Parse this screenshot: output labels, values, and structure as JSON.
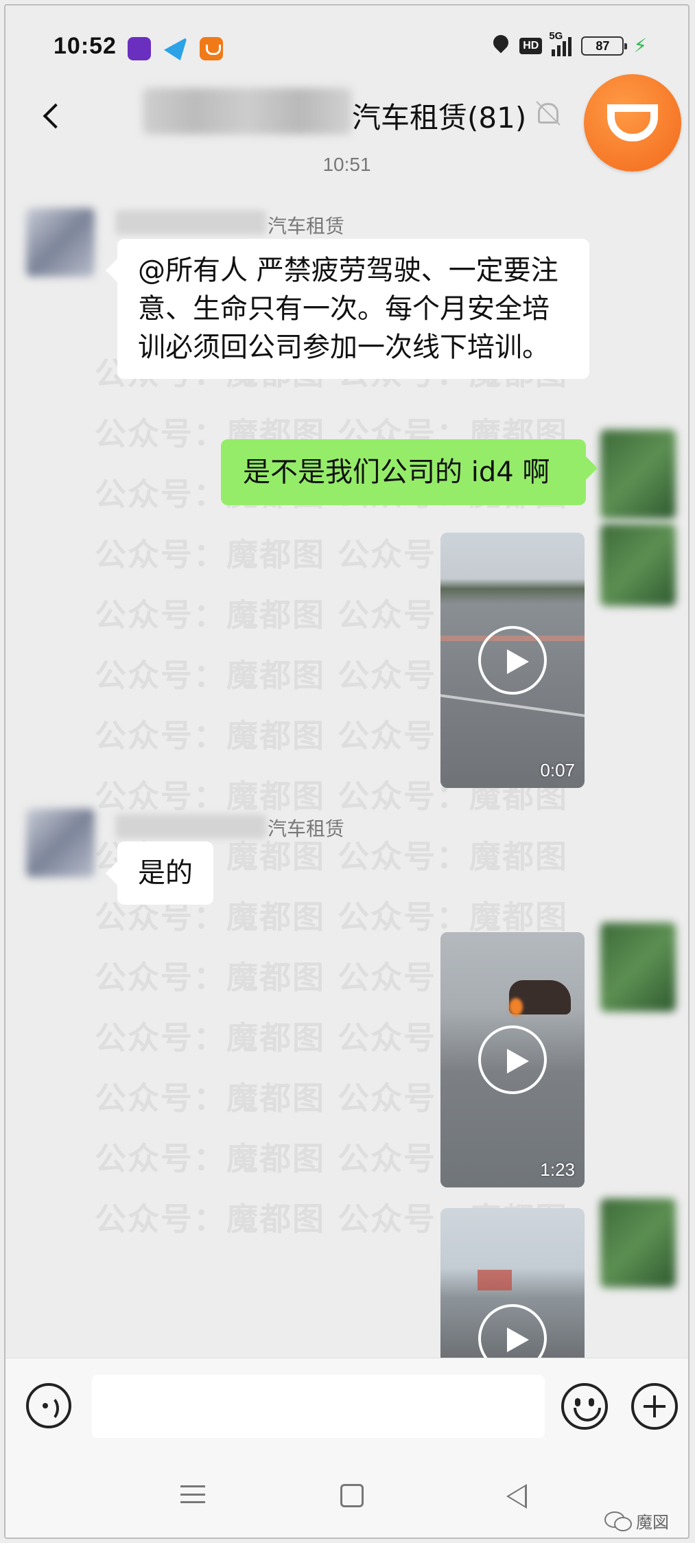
{
  "status_bar": {
    "time": "10:52",
    "network": "5G",
    "hd": "HD",
    "battery": "87",
    "charging": "⚡"
  },
  "header": {
    "title": "汽车租赁(81)",
    "back_icon": "chevron-left-icon",
    "mute_icon": "bell-off-icon"
  },
  "watermark": {
    "text": "公众号：魔都图    公众号：魔都图"
  },
  "messages": {
    "timestamp": "10:51",
    "m1": {
      "sender_tag": "汽车租赁",
      "text": "@所有人    严禁疲劳驾驶、一定要注意、生命只有一次。每个月安全培训必须回公司参加一次线下培训。"
    },
    "m2": {
      "text": "是不是我们公司的 id4 啊"
    },
    "m3": {
      "duration": "0:07"
    },
    "m4": {
      "sender_tag": "汽车租赁",
      "text": "是的"
    },
    "m5": {
      "duration": "1:23"
    }
  },
  "input_bar": {
    "placeholder": ""
  },
  "footer": {
    "brand": "魔図"
  }
}
